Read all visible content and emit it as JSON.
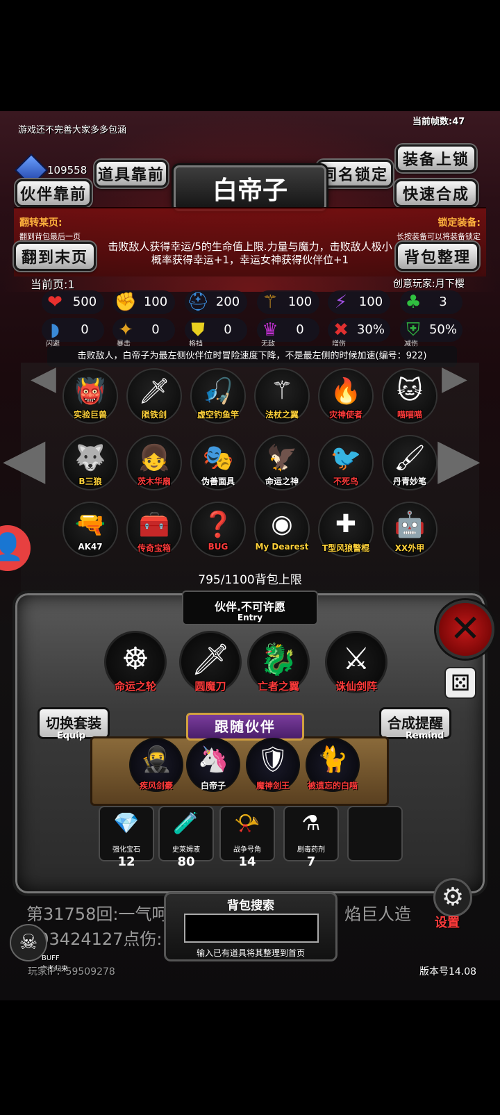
{
  "header": {
    "notice": "游戏还不完善大家多多包涵",
    "fps": "当前帧数:47",
    "currency": "109558"
  },
  "buttons": {
    "item_front": "道具靠前",
    "partner_front": "伙伴靠前",
    "same_name_lock": "同名锁定",
    "equip_lock": "装备上锁",
    "quick_merge": "快速合成",
    "flip_last": "翻到末页",
    "bag_sort": "背包整理",
    "switch_set": "切换套装",
    "switch_set_sub": "Equip",
    "merge_remind": "合成提醒",
    "merge_remind_sub": "Remind",
    "settings": "设置"
  },
  "partner": {
    "name": "白帝子",
    "description": "击败敌人获得幸运/5的生命值上限.力量与魔力，击败敌人极小概率获得幸运+1，幸运女神获得伙伴位+1",
    "passive": "击败敌人，白帝子为最左侧伙伴位时冒险速度下降，不是最左侧的时候加速(编号：922)"
  },
  "info": {
    "flip_title": "翻转某页:",
    "flip_hint": "翻到背包最后一页",
    "lock_title": "锁定装备:",
    "lock_hint": "长按装备可以将装备锁定",
    "current_page": "当前页:1",
    "creator": "创意玩家:月下樱"
  },
  "stats": [
    {
      "icon": "heart-icon",
      "glyph": "❤",
      "color": "#e8302e",
      "value": "500",
      "caption": ""
    },
    {
      "icon": "muscle-icon",
      "glyph": "✊",
      "color": "#e8c020",
      "value": "100",
      "caption": ""
    },
    {
      "icon": "helmet-icon",
      "glyph": "⛑",
      "color": "#3a8ad8",
      "value": "200",
      "caption": ""
    },
    {
      "icon": "staff-icon",
      "glyph": "⚚",
      "color": "#e0a020",
      "value": "100",
      "caption": ""
    },
    {
      "icon": "lightning-icon",
      "glyph": "⚡",
      "color": "#a050e0",
      "value": "100",
      "caption": ""
    },
    {
      "icon": "clover-icon",
      "glyph": "♣",
      "color": "#30c040",
      "value": "3",
      "caption": ""
    },
    {
      "icon": "dodge-icon",
      "glyph": "◗",
      "color": "#3a8ad8",
      "value": "0",
      "caption": "闪避"
    },
    {
      "icon": "crit-icon",
      "glyph": "✦",
      "color": "#e0a020",
      "value": "0",
      "caption": "暴击"
    },
    {
      "icon": "block-icon",
      "glyph": "⛊",
      "color": "#e8d020",
      "value": "0",
      "caption": "格挡"
    },
    {
      "icon": "invincible-icon",
      "glyph": "♛",
      "color": "#c030d0",
      "value": "0",
      "caption": "无敌"
    },
    {
      "icon": "damage-up-icon",
      "glyph": "✖",
      "color": "#e03030",
      "value": "30%",
      "caption": "增伤"
    },
    {
      "icon": "damage-down-icon",
      "glyph": "⛨",
      "color": "#30b040",
      "value": "50%",
      "caption": "减伤"
    }
  ],
  "items": [
    {
      "name": "实验巨兽",
      "glyph": "👹",
      "color": "#ffd23a"
    },
    {
      "name": "陨铁剑",
      "glyph": "🗡",
      "color": "#ffd23a"
    },
    {
      "name": "虚空钓鱼竿",
      "glyph": "🎣",
      "color": "#ffd23a"
    },
    {
      "name": "法杖之翼",
      "glyph": "⚚",
      "color": "#ffd23a"
    },
    {
      "name": "灾神使者",
      "glyph": "🔥",
      "color": "#ff3b3b"
    },
    {
      "name": "喵喵喵",
      "glyph": "🐱",
      "color": "#ff3b3b"
    },
    {
      "name": "B三狼",
      "glyph": "🐺",
      "color": "#ffd23a"
    },
    {
      "name": "茨木华扇",
      "glyph": "👧",
      "color": "#ff3b3b"
    },
    {
      "name": "伪善面具",
      "glyph": "🎭",
      "color": "#ffffff"
    },
    {
      "name": "命运之神",
      "glyph": "🦅",
      "color": "#ffffff"
    },
    {
      "name": "不死鸟",
      "glyph": "🐦",
      "color": "#ff3b3b"
    },
    {
      "name": "丹青妙笔",
      "glyph": "🖌",
      "color": "#ffffff"
    },
    {
      "name": "AK47",
      "glyph": "🔫",
      "color": "#ffffff"
    },
    {
      "name": "传奇宝箱",
      "glyph": "🧰",
      "color": "#ff3b3b"
    },
    {
      "name": "BUG",
      "glyph": "❓",
      "color": "#ff3b3b"
    },
    {
      "name": "My Dearest",
      "glyph": "◉",
      "color": "#ffd23a"
    },
    {
      "name": "T型风狼警棍",
      "glyph": "✚",
      "color": "#ffd23a"
    },
    {
      "name": "XX外甲",
      "glyph": "🤖",
      "color": "#ffd23a"
    }
  ],
  "bag_capacity": "795/1100背包上限",
  "equip_panel": {
    "title": "伙伴.不可许愿",
    "subtitle": "Entry",
    "slots": [
      {
        "name": "命运之轮",
        "glyph": "☸"
      },
      {
        "name": "圆魔刀",
        "glyph": "🗡"
      },
      {
        "name": "亡者之翼",
        "glyph": "🐉"
      },
      {
        "name": "诛仙剑阵",
        "glyph": "⚔"
      }
    ]
  },
  "follow": {
    "banner": "跟随伙伴",
    "partners": [
      {
        "name": "疾风剑豪",
        "glyph": "🥷"
      },
      {
        "name": "白帝子",
        "glyph": "🦄"
      },
      {
        "name": "魔神剑王",
        "glyph": "🛡"
      },
      {
        "name": "被遗忘的白喵",
        "glyph": "🐈"
      }
    ]
  },
  "consumables": [
    {
      "name": "强化宝石",
      "glyph": "💎",
      "count": "12"
    },
    {
      "name": "史莱姆液",
      "glyph": "🧪",
      "count": "80"
    },
    {
      "name": "战争号角",
      "glyph": "📯",
      "count": "14"
    },
    {
      "name": "剧毒药剂",
      "glyph": "⚗",
      "count": "7"
    }
  ],
  "log": {
    "line1": "第31758回:一气呵",
    "line1b": "焰巨人造",
    "line2": "103424127点伤:"
  },
  "search": {
    "title": "背包搜索",
    "value": "",
    "hint": "输入已有道具将其整理到首页"
  },
  "footer": {
    "buff": "BUFF",
    "buff_sub": "亡者归来",
    "player_ip": "玩家IP：59509278",
    "version": "版本号14.08"
  }
}
